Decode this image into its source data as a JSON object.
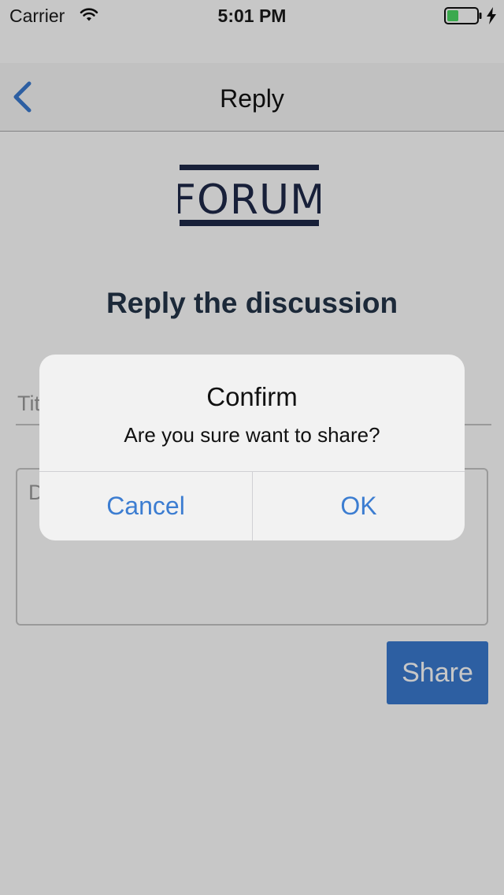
{
  "status_bar": {
    "carrier": "Carrier",
    "time": "5:01 PM"
  },
  "nav": {
    "title": "Reply",
    "back_icon": "chevron-left-icon"
  },
  "content": {
    "logo_text": "FORUM",
    "heading": "Reply the discussion",
    "title_placeholder": "Title",
    "description_placeholder": "Description",
    "share_label": "Share"
  },
  "dialog": {
    "title": "Confirm",
    "message": "Are you sure want to share?",
    "cancel_label": "Cancel",
    "ok_label": "OK"
  },
  "colors": {
    "accent": "#3a7ad0",
    "heading": "#25354a",
    "logo": "#1f2a4a",
    "battery_fill": "#4cd964"
  }
}
